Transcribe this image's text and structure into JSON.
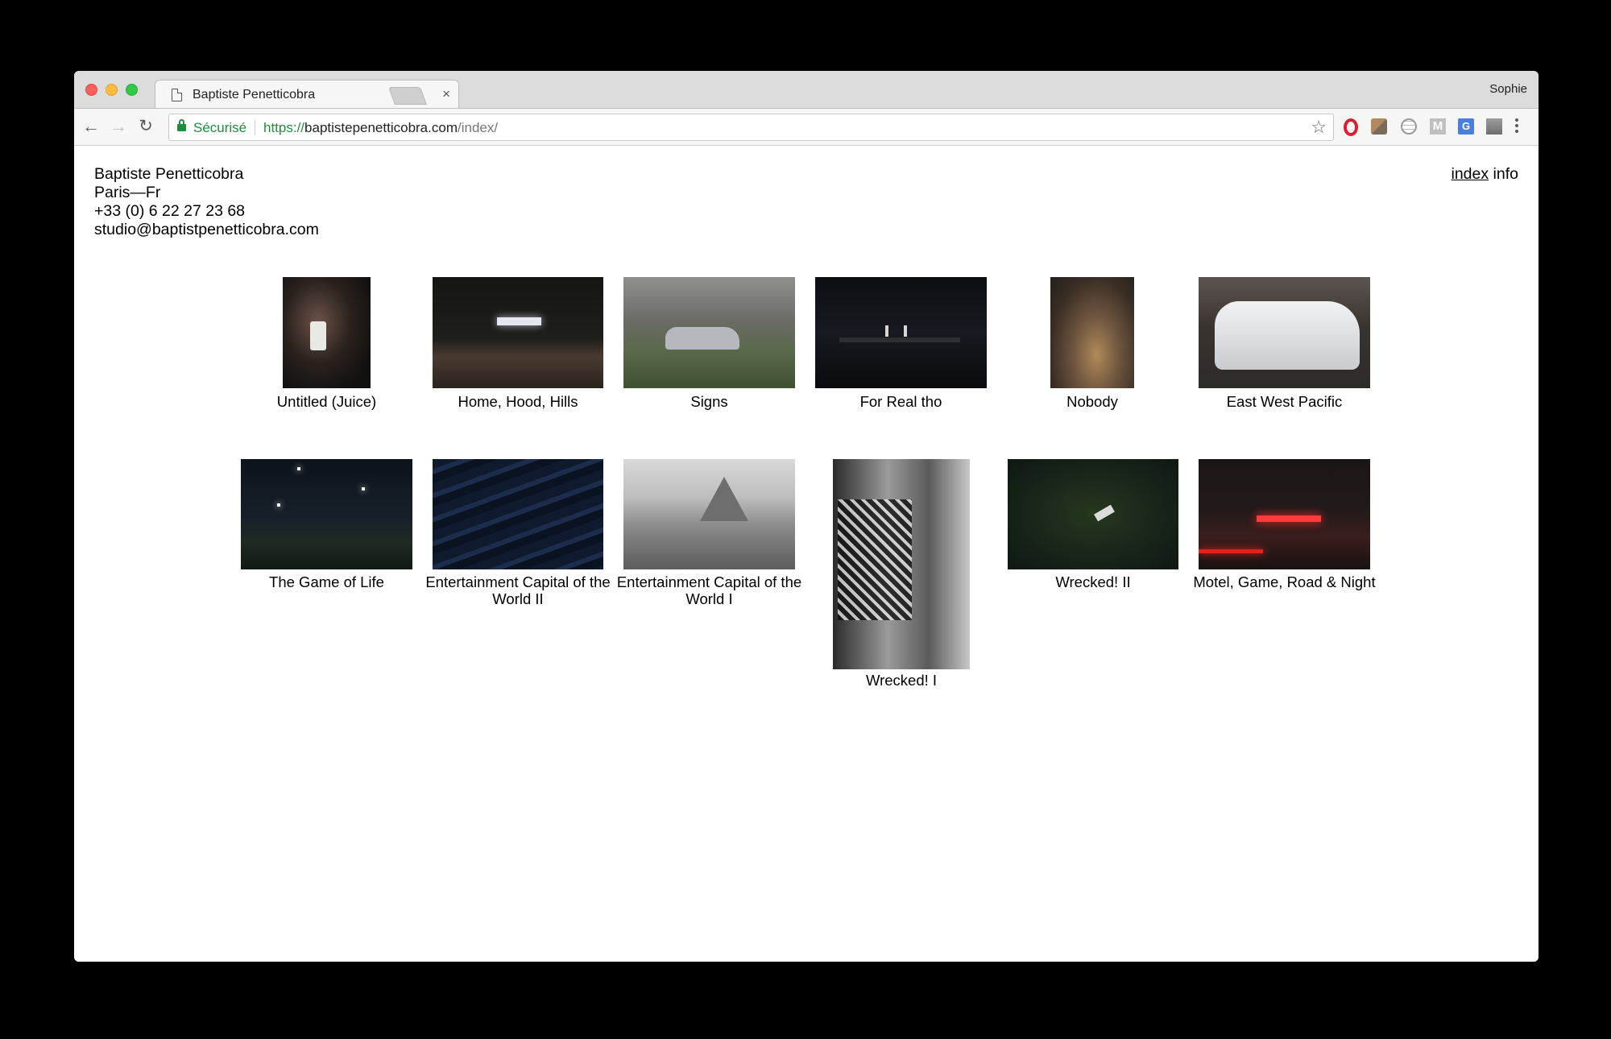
{
  "browser": {
    "tab_title": "Baptiste Penetticobra",
    "tab_close": "×",
    "profile_name": "Sophie",
    "secure_label": "Sécurisé",
    "url_scheme": "https://",
    "url_host": "baptistepenetticobra.com",
    "url_path": "/index/",
    "back_glyph": "←",
    "forward_glyph": "→",
    "reload_glyph": "↻",
    "star_glyph": "☆",
    "extensions": [
      "opera-icon",
      "puzzle-extension-icon",
      "globe-extension-icon",
      "gmail-extension-icon",
      "translate-extension-icon",
      "photo-extension-icon"
    ],
    "gmail_letter": "M",
    "translate_letter": "G"
  },
  "site": {
    "name": "Baptiste Penetticobra",
    "location": "Paris—Fr",
    "phone": "+33 (0) 6 22 27 23 68",
    "email": "studio@baptistpenetticobra.com",
    "nav": {
      "index": "index",
      "info": "info"
    }
  },
  "projects": [
    {
      "title": "Untitled (Juice)"
    },
    {
      "title": "Home, Hood, Hills"
    },
    {
      "title": "Signs"
    },
    {
      "title": "For Real tho"
    },
    {
      "title": "Nobody"
    },
    {
      "title": "East West Pacific"
    },
    {
      "title": "The Game of Life"
    },
    {
      "title": "Entertainment Capital of the World II"
    },
    {
      "title": "Entertainment Capital of the World I"
    },
    {
      "title": "Wrecked! I"
    },
    {
      "title": "Wrecked! II"
    },
    {
      "title": "Motel, Game, Road & Night"
    }
  ]
}
